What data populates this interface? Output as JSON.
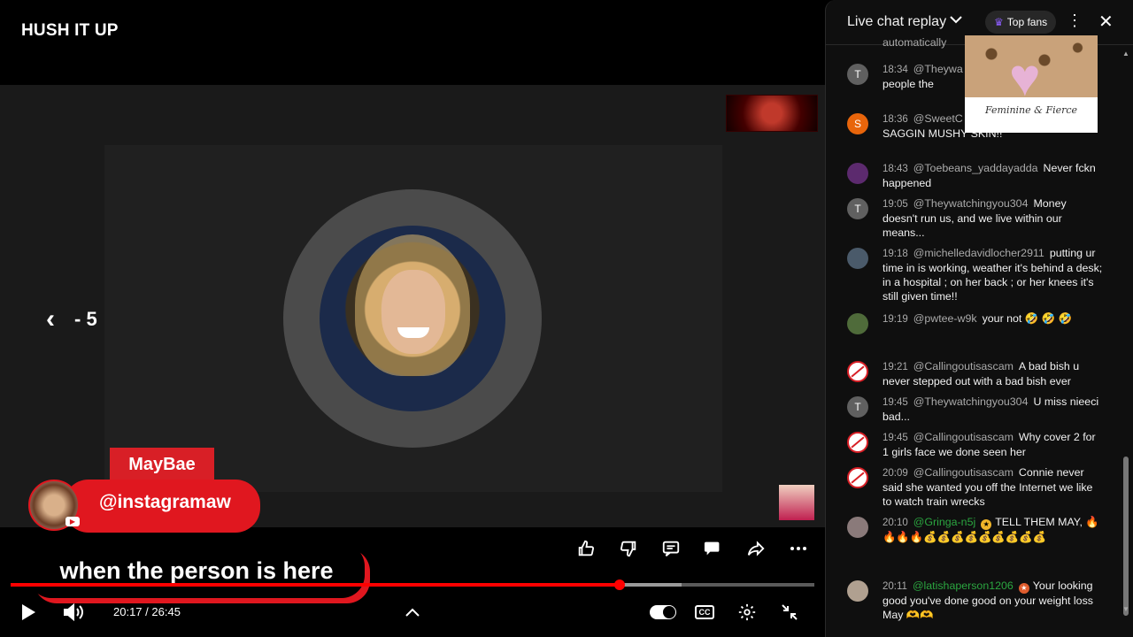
{
  "video": {
    "title": "HUSH IT UP",
    "seek_label": "- 5",
    "overlay_name": "MayBae",
    "overlay_handle": "@instagramaw",
    "caption": "when the person is here",
    "time_current": "20:17",
    "time_separator": "/",
    "time_total": "26:45",
    "progress_fraction": 0.758,
    "buffered_fraction": 0.835,
    "accent_color": "#ff0000"
  },
  "actions": {
    "like": "thumbs-up-icon",
    "dislike": "thumbs-down-icon",
    "comment": "comment-icon",
    "chat": "chat-icon",
    "share": "share-icon",
    "more": "more-horizontal-icon"
  },
  "chat": {
    "title": "Live chat replay",
    "top_fans": "Top fans",
    "truncated_top": "automatically",
    "messages": [
      {
        "avatar": "T",
        "avatar_color": "#606060",
        "time": "18:34",
        "author": "@Theywa",
        "text": "u talking about i... to tell people the"
      },
      {
        "avatar": "S",
        "avatar_color": "#e8650b",
        "time": "18:36",
        "author": "@SweetC",
        "text": "NOTHING SEXY ABOUT SAGGIN MUSHY SKIN!!"
      },
      {
        "avatar": "",
        "avatar_color": "#5c2a6e",
        "time": "18:43",
        "author": "@Toebeans_yaddayadda",
        "text": "Never fckn happened"
      },
      {
        "avatar": "T",
        "avatar_color": "#606060",
        "time": "19:05",
        "author": "@Theywatchingyou304",
        "text": "Money doesn't run us, and we live within our means..."
      },
      {
        "avatar": "",
        "avatar_color": "#4a5a6a",
        "time": "19:18",
        "author": "@michelledavidlocher2911",
        "text": "putting ur time in is working, weather it's behind a desk; in a hospital ; on her back ; or her knees it's still given time!!"
      },
      {
        "avatar": "",
        "avatar_color": "#4f6b3a",
        "time": "19:19",
        "author": "@pwtee-w9k",
        "text": "your not 🤣 🤣 🤣"
      },
      {
        "avatar": "",
        "avatar_color": "scam",
        "time": "19:21",
        "author": "@Callingoutisascam",
        "text": "A bad bish u never stepped out with a bad bish ever"
      },
      {
        "avatar": "T",
        "avatar_color": "#606060",
        "time": "19:45",
        "author": "@Theywatchingyou304",
        "text": "U miss nieeci bad..."
      },
      {
        "avatar": "",
        "avatar_color": "scam",
        "time": "19:45",
        "author": "@Callingoutisascam",
        "text": "Why cover 2 for 1 girls face we done seen her"
      },
      {
        "avatar": "",
        "avatar_color": "scam",
        "time": "20:09",
        "author": "@Callingoutisascam",
        "text": "Connie never said she wanted you off the Internet we like to watch train wrecks"
      },
      {
        "avatar": "",
        "avatar_color": "#8a7a7a",
        "time": "20:10",
        "author": "@Gringa-n5j",
        "text": "TELL THEM MAY, 🔥🔥🔥🔥💰💰💰💰💰💰💰💰💰",
        "member": true
      },
      {
        "avatar": "",
        "avatar_color": "#b0a090",
        "time": "20:11",
        "author": "@latishaperson1206",
        "text": "Your looking good you've done good on your weight loss May 🫶🫶",
        "member": true
      }
    ]
  },
  "overlay_art": {
    "script_text": "Feminine & Fierce"
  }
}
